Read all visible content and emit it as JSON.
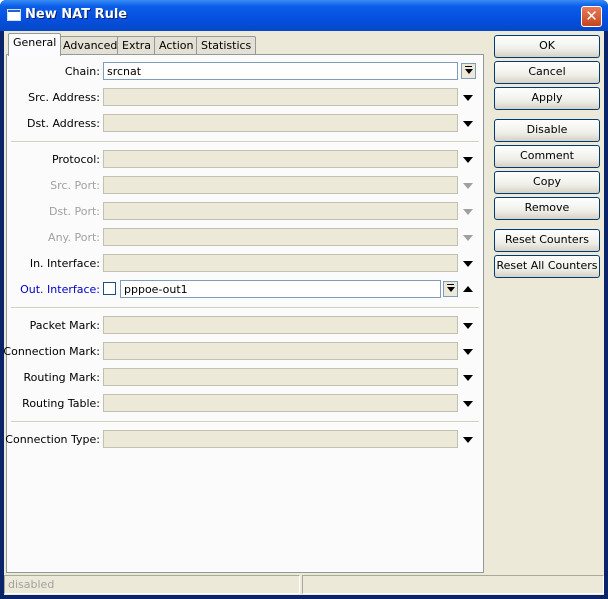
{
  "window": {
    "title": "New NAT Rule",
    "close_glyph": "✕",
    "icon": "window-icon"
  },
  "tabs": [
    {
      "label": "General",
      "active": true
    },
    {
      "label": "Advanced"
    },
    {
      "label": "Extra"
    },
    {
      "label": "Action"
    },
    {
      "label": "Statistics"
    }
  ],
  "fields": {
    "chain": {
      "label": "Chain:",
      "value": "srcnat"
    },
    "src_address": {
      "label": "Src. Address:"
    },
    "dst_address": {
      "label": "Dst. Address:"
    },
    "protocol": {
      "label": "Protocol:"
    },
    "src_port": {
      "label": "Src. Port:"
    },
    "dst_port": {
      "label": "Dst. Port:"
    },
    "any_port": {
      "label": "Any. Port:"
    },
    "in_interface": {
      "label": "In. Interface:"
    },
    "out_interface": {
      "label": "Out. Interface:",
      "value": "pppoe-out1",
      "negate_checked": false
    },
    "packet_mark": {
      "label": "Packet Mark:"
    },
    "connection_mark": {
      "label": "Connection Mark:"
    },
    "routing_mark": {
      "label": "Routing Mark:"
    },
    "routing_table": {
      "label": "Routing Table:"
    },
    "connection_type": {
      "label": "Connection Type:"
    }
  },
  "buttons": {
    "ok": "OK",
    "cancel": "Cancel",
    "apply": "Apply",
    "disable": "Disable",
    "comment": "Comment",
    "copy": "Copy",
    "remove": "Remove",
    "reset_counters": "Reset Counters",
    "reset_all_counters": "Reset All Counters"
  },
  "status": {
    "left": "disabled",
    "right": ""
  },
  "colors": {
    "title_bar": "#0a5ee8",
    "dialog_bg": "#ece9d8",
    "active_label": "#0000c8"
  }
}
